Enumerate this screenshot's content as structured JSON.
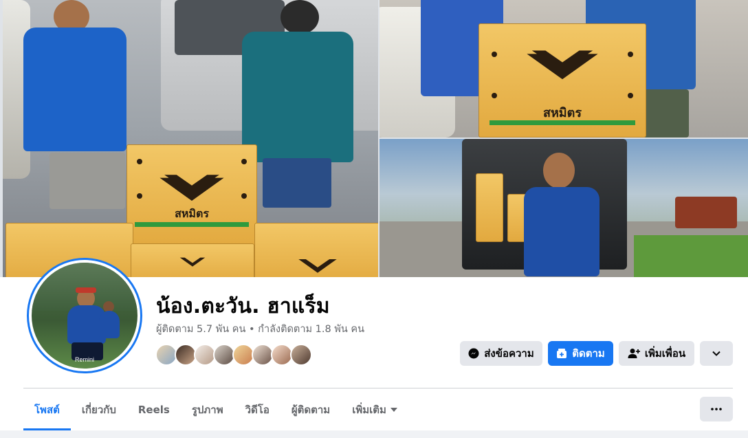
{
  "profile": {
    "name": "น้อง.ตะวัน. ฮาแร็ม",
    "stats": "ผู้ติดตาม 5.7 พัน คน • กำลังติดตาม 1.8 พัน คน",
    "avatar_watermark": "Remini"
  },
  "cover": {
    "box_brand": "สหมิตร"
  },
  "actions": {
    "message_label": "ส่งข้อความ",
    "follow_label": "ติดตาม",
    "add_friend_label": "เพิ่มเพื่อน",
    "message_icon": "messenger-icon",
    "follow_icon": "follow-icon",
    "add_friend_icon": "add-friend-icon",
    "expand_icon": "chevron-down-icon"
  },
  "tabs": [
    {
      "label": "โพสต์",
      "active": true
    },
    {
      "label": "เกี่ยวกับ",
      "active": false
    },
    {
      "label": "Reels",
      "active": false
    },
    {
      "label": "รูปภาพ",
      "active": false
    },
    {
      "label": "วิดีโอ",
      "active": false
    },
    {
      "label": "ผู้ติดตาม",
      "active": false
    },
    {
      "label": "เพิ่มเติม",
      "active": false
    }
  ],
  "colors": {
    "accent": "#1877f2",
    "secondary_button": "#e4e6eb",
    "muted_text": "#65676b"
  }
}
